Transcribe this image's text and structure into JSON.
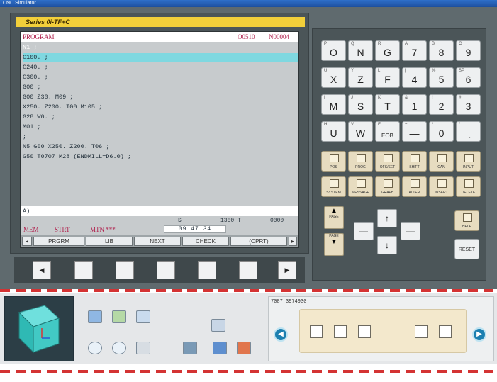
{
  "window": {
    "title": "CNC Simulator"
  },
  "cnc": {
    "series": "Series 0i-TF+C",
    "header": {
      "title": "PROGRAM",
      "onum": "O0510",
      "nnum": "N00004"
    },
    "program_lines": [
      "N1 ;",
      "C100. ;",
      "C240. ;",
      "C300. ;",
      "G00 ;",
      "G00 Z30. M09 ;",
      "X250. Z200. T00 M105 ;",
      "G28 W0. ;",
      "M01 ;",
      ";",
      "N5 G00 X250. Z200. T06 ;",
      "G50 T0707 M28 (ENDMILL=D6.0) ;"
    ],
    "input": "A)_",
    "status1": {
      "s": "S",
      "val": "1300 T",
      "code": "0000"
    },
    "status2": {
      "mode": "MEM",
      "strt": "STRT",
      "mtn": "MTN ***"
    },
    "digits": "09 47 34",
    "softkeys": [
      "PRGRM",
      "LIB",
      "NEXT",
      "CHECK",
      "(OPRT)"
    ]
  },
  "keypad": {
    "letters": [
      {
        "k": "O",
        "s": "P"
      },
      {
        "k": "N",
        "s": "Q"
      },
      {
        "k": "G",
        "s": "R"
      },
      {
        "k": "7",
        "s": "A"
      },
      {
        "k": "8",
        "s": "B"
      },
      {
        "k": "9",
        "s": "C"
      },
      {
        "k": "X",
        "s": "U"
      },
      {
        "k": "Z",
        "s": "Y"
      },
      {
        "k": "F",
        "s": "L"
      },
      {
        "k": "4",
        "s": "["
      },
      {
        "k": "5",
        "s": "%"
      },
      {
        "k": "6",
        "s": "SP"
      },
      {
        "k": "M",
        "s": "I"
      },
      {
        "k": "S",
        "s": "J"
      },
      {
        "k": "T",
        "s": "K"
      },
      {
        "k": "1",
        "s": "&"
      },
      {
        "k": "2",
        "s": "!"
      },
      {
        "k": "3",
        "s": "#"
      },
      {
        "k": "U",
        "s": "H"
      },
      {
        "k": "W",
        "s": "V"
      },
      {
        "k": "EOB",
        "s": "E"
      },
      {
        "k": "—",
        "s": "+"
      },
      {
        "k": "0",
        "s": "*"
      },
      {
        "k": ". ,",
        "s": "/"
      }
    ],
    "func_row1": [
      "POS",
      "PROG",
      "OFS/SET",
      "SHIFT",
      "CAN",
      "INPUT"
    ],
    "func_row2": [
      "SYSTEM",
      "MESSAGE",
      "GRAPH",
      "ALTER",
      "INSERT",
      "DELETE"
    ],
    "page_up": "PAGE",
    "page_down": "PAGE",
    "help": "HELP",
    "reset": "RESET"
  },
  "bottom": {
    "status_line": "7087  3974930"
  }
}
